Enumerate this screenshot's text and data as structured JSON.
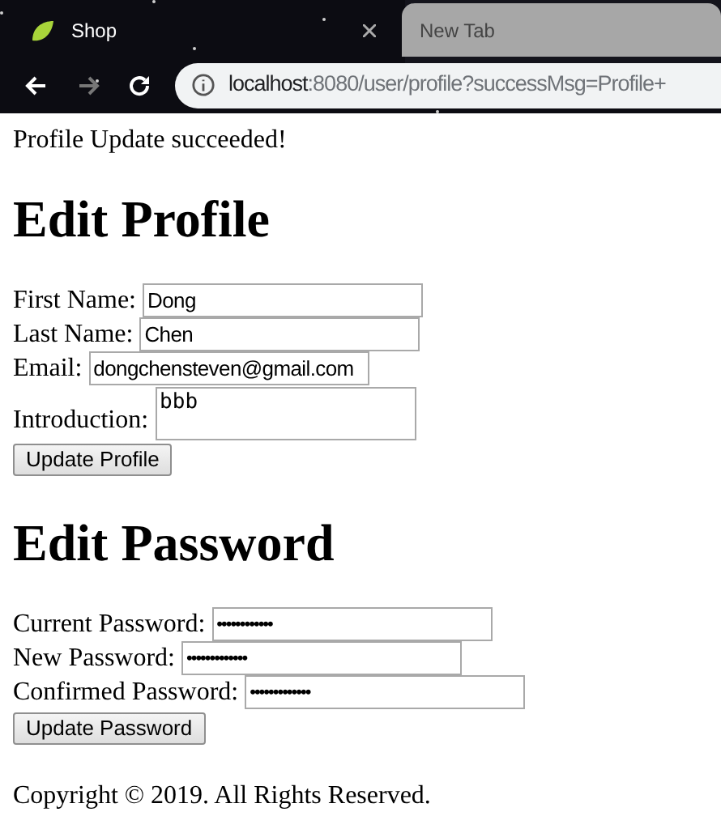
{
  "browser": {
    "tabs": [
      {
        "title": "Shop",
        "selected": true
      },
      {
        "title": "New Tab",
        "selected": false
      }
    ],
    "url": {
      "host": "localhost",
      "rest": ":8080/user/profile?successMsg=Profile+"
    }
  },
  "message": "Profile Update succeeded!",
  "profile_form": {
    "heading": "Edit Profile",
    "fields": [
      {
        "label": "First Name:",
        "value": "Dong",
        "kind": "text"
      },
      {
        "label": "Last Name:",
        "value": "Chen",
        "kind": "text"
      },
      {
        "label": "Email:",
        "value": "dongchensteven@gmail.com",
        "kind": "text"
      },
      {
        "label": "Introduction:",
        "value": "bbb",
        "kind": "textarea"
      }
    ],
    "button": "Update Profile"
  },
  "password_form": {
    "heading": "Edit Password",
    "fields": [
      {
        "label": "Current Password:",
        "value": "••••••••••••",
        "kind": "password"
      },
      {
        "label": "New Password:",
        "value": "•••••••••••••",
        "kind": "password"
      },
      {
        "label": "Confirmed Password:",
        "value": "•••••••••••••",
        "kind": "password"
      }
    ],
    "button": "Update Password"
  },
  "footer": "Copyright © 2019. All Rights Reserved."
}
